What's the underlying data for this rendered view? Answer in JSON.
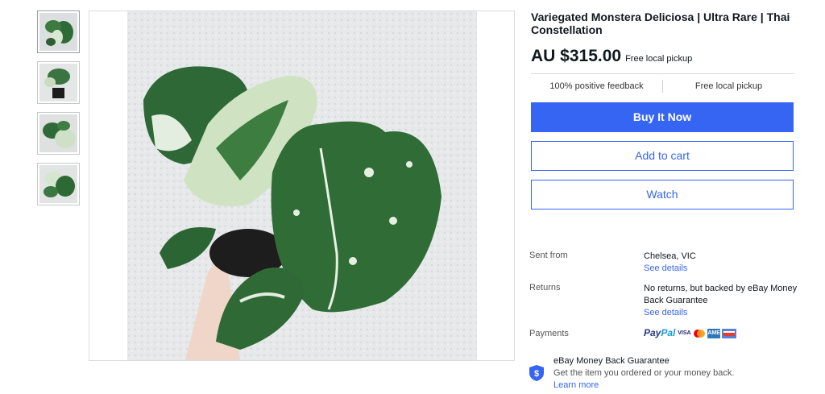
{
  "listing": {
    "title": "Variegated Monstera Deliciosa | Ultra Rare | Thai Constellation",
    "price": "AU $315.00",
    "price_note": "Free local pickup",
    "feature_feedback": "100% positive feedback",
    "feature_pickup": "Free local pickup"
  },
  "buttons": {
    "buy": "Buy It Now",
    "cart": "Add to cart",
    "watch": "Watch"
  },
  "shipping": {
    "sent_from_label": "Sent from",
    "sent_from_value": "Chelsea, VIC",
    "see_details": "See details",
    "returns_label": "Returns",
    "returns_value": "No returns, but backed by eBay Money Back Guarantee",
    "payments_label": "Payments",
    "paypal_a": "Pay",
    "paypal_b": "Pal",
    "card_visa": "VISA",
    "card_amex": "AMEX"
  },
  "guarantee": {
    "title": "eBay Money Back Guarantee",
    "subtitle": "Get the item you ordered or your money back.",
    "learn_more": "Learn more"
  },
  "colors": {
    "accent": "#3665f3",
    "leaf_dark": "#2f6b37",
    "leaf_light": "#e6efe0"
  }
}
